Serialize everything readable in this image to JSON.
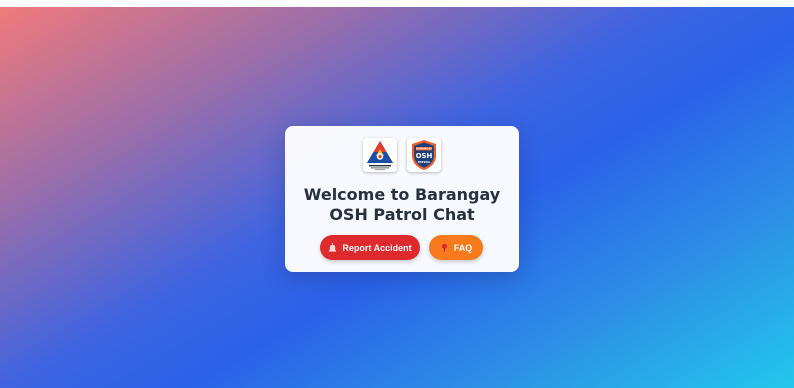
{
  "page": {
    "title": "Welcome to Barangay OSH Patrol Chat"
  },
  "logos": {
    "dole_seal_text": "DEPARTMENT OF LABOR AND EMPLOYMENT",
    "osh_badge_top": "BARANGAY",
    "osh_badge_main": "OSH",
    "osh_badge_bottom": "PATROL"
  },
  "actions": {
    "report_label": "Report Accident",
    "report_icon": "siren-icon",
    "faq_label": "FAQ",
    "faq_icon": "pin-icon"
  },
  "colors": {
    "report_button": "#de2a2c",
    "faq_button": "#f87a1c",
    "title_text": "#27313f"
  }
}
